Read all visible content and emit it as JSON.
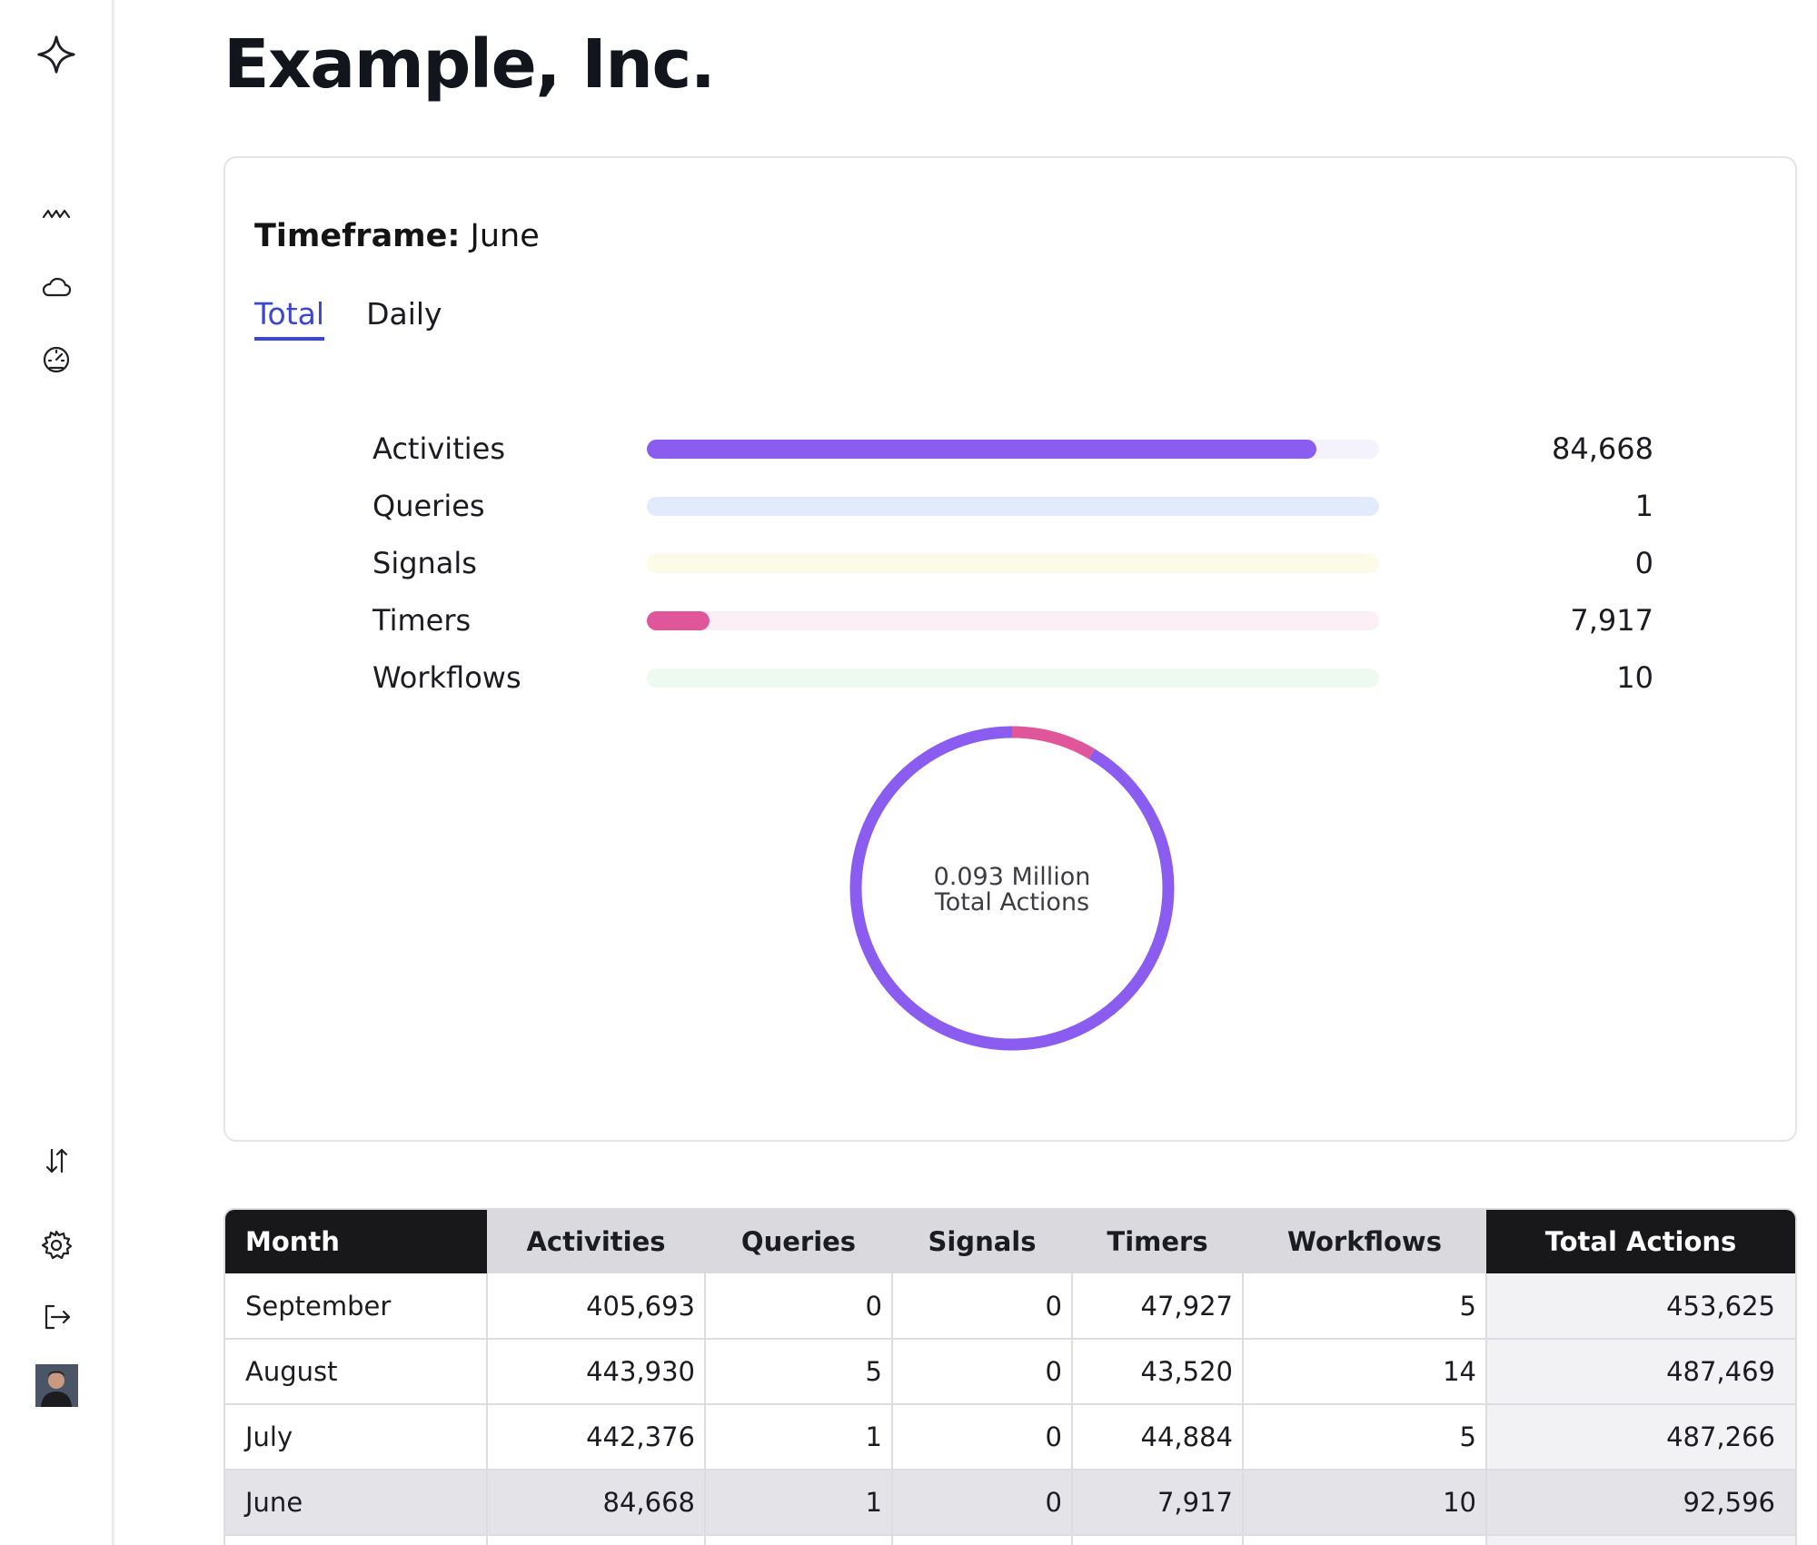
{
  "sidebar": {
    "icons": [
      "logo-icon",
      "activity-icon",
      "cloud-icon",
      "gauge-icon",
      "sort-arrows-icon",
      "gear-icon",
      "logout-icon",
      "avatar"
    ]
  },
  "page": {
    "title": "Example, Inc."
  },
  "summary": {
    "timeframe_label": "Timeframe:",
    "timeframe_value": "June",
    "tabs": [
      {
        "label": "Total",
        "active": true
      },
      {
        "label": "Daily",
        "active": false
      }
    ],
    "max_value": 92596,
    "metrics": [
      {
        "label": "Activities",
        "value": "84,668",
        "fill_fraction": 0.914,
        "color": "#8a5cf0",
        "track_color": "#f4f2fd"
      },
      {
        "label": "Queries",
        "value": "1",
        "fill_fraction": 0.0,
        "color": "#4a7ee8",
        "track_color": "#e2ebfb"
      },
      {
        "label": "Signals",
        "value": "0",
        "fill_fraction": 0.0,
        "color": "#e8e250",
        "track_color": "#fcfbe8"
      },
      {
        "label": "Timers",
        "value": "7,917",
        "fill_fraction": 0.085,
        "color": "#e0569a",
        "track_color": "#fbeff5"
      },
      {
        "label": "Workflows",
        "value": "10",
        "fill_fraction": 0.0,
        "color": "#4cc46a",
        "track_color": "#eef9ef"
      }
    ],
    "donut": {
      "line1": "0.093 Million",
      "line2": "Total Actions",
      "segments": [
        {
          "name": "Activities",
          "fraction": 0.9144,
          "color": "#8a5cf0"
        },
        {
          "name": "Timers",
          "fraction": 0.0856,
          "color": "#e0569a"
        }
      ]
    }
  },
  "table": {
    "columns": [
      "Month",
      "Activities",
      "Queries",
      "Signals",
      "Timers",
      "Workflows",
      "Total Actions"
    ],
    "rows": [
      [
        "September",
        "405,693",
        "0",
        "0",
        "47,927",
        "5",
        "453,625"
      ],
      [
        "August",
        "443,930",
        "5",
        "0",
        "43,520",
        "14",
        "487,469"
      ],
      [
        "July",
        "442,376",
        "1",
        "0",
        "44,884",
        "5",
        "487,266"
      ],
      [
        "June",
        "84,668",
        "1",
        "0",
        "7,917",
        "10",
        "92,596"
      ]
    ],
    "selected_row": 3
  }
}
